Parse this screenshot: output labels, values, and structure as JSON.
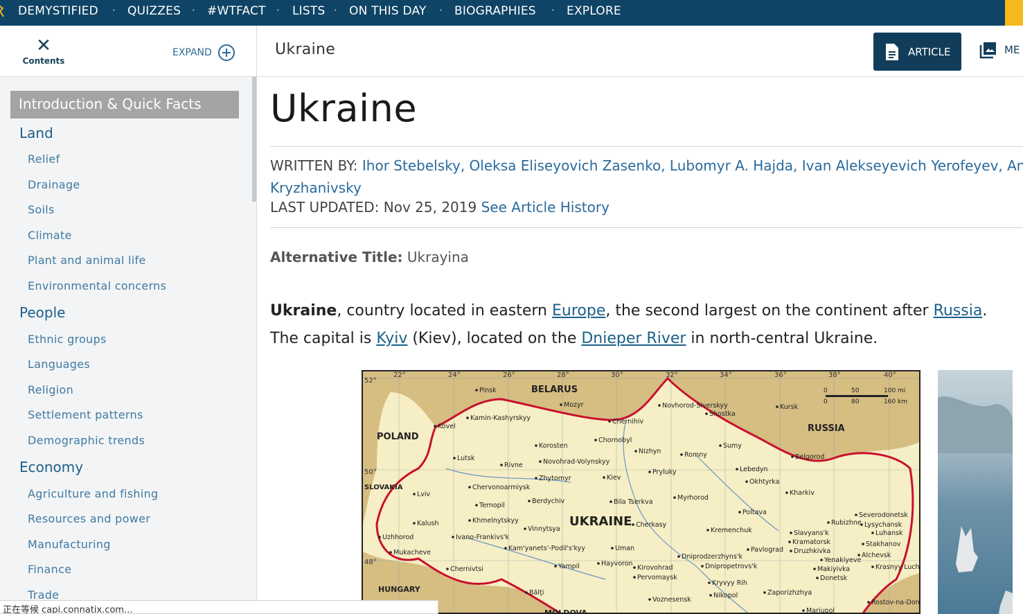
{
  "topnav": {
    "items": [
      "DEMYSTIFIED",
      "QUIZZES",
      "#WTFACT",
      "LISTS",
      "ON THIS DAY",
      "BIOGRAPHIES",
      "EXPLORE"
    ],
    "separator": "·"
  },
  "toc_header": {
    "close_label": "Contents",
    "expand_label": "EXPAND"
  },
  "sidebar": {
    "active": "Introduction & Quick Facts",
    "sections": [
      {
        "label": "Land",
        "items": [
          "Relief",
          "Drainage",
          "Soils",
          "Climate",
          "Plant and animal life",
          "Environmental concerns"
        ]
      },
      {
        "label": "People",
        "items": [
          "Ethnic groups",
          "Languages",
          "Religion",
          "Settlement patterns",
          "Demographic trends"
        ]
      },
      {
        "label": "Economy",
        "items": [
          "Agriculture and fishing",
          "Resources and power",
          "Manufacturing",
          "Finance",
          "Trade"
        ]
      }
    ]
  },
  "header": {
    "title": "Ukraine",
    "article_label": "ARTICLE",
    "media_label": "ME"
  },
  "article": {
    "title": "Ukraine",
    "written_by_label": "WRITTEN BY:",
    "authors_line1": "Ihor Stebelsky, Oleksa Eliseyovich Zasenko, Lubomyr A. Hajda, Ivan Alekseyevich Yerofeyev, Andr",
    "authors_line2": "Kryzhanivsky",
    "last_updated_label": "LAST UPDATED:",
    "last_updated": "Nov 25, 2019",
    "history_link": "See Article History",
    "alt_title_label": "Alternative Title:",
    "alt_title": "Ukrayina",
    "intro": {
      "bold": "Ukraine",
      "t1": ", country located in eastern ",
      "l1": "Europe",
      "t2": ", the second largest on the continent after ",
      "l2": "Russia",
      "t3": ".",
      "t4": "The capital is ",
      "l3": "Kyiv",
      "t5": " (Kiev), located on the ",
      "l4": "Dnieper River",
      "t6": " in north-central Ukraine."
    }
  },
  "map": {
    "country_labels": [
      "BELARUS",
      "POLAND",
      "RUSSIA",
      "SLOVAKIA",
      "HUNGARY",
      "MOLDOVA",
      "UKRAINE"
    ],
    "cities": [
      "Pinsk",
      "Mozyr",
      "Kovel",
      "Kamin-Kashyrskyy",
      "Chernihiv",
      "Novhorod-Siverskyy",
      "Shostka",
      "Kursk",
      "Korosten",
      "Chornobyl",
      "Nizhyn",
      "Romny",
      "Sumy",
      "Lutsk",
      "Rivne",
      "Novohrad-Volynskyy",
      "Zhytomyr",
      "Kiev",
      "Pryluky",
      "Lebedyn",
      "Okhtyrka",
      "Belgorod",
      "Chervonoarmiysk",
      "Lviv",
      "Ternopil",
      "Berdychiv",
      "Bila Tserkva",
      "Myrhorod",
      "Kharkiv",
      "Poltava",
      "Kalush",
      "Khmelnytskyy",
      "Vinnytsya",
      "Cherkasy",
      "Kremenchuk",
      "Rubizhne",
      "Lysychansk",
      "Severodonetsk",
      "Luhansk",
      "Ivano-Frankivs'k",
      "Uzhhorod",
      "Mukacheve",
      "Kam'yanets'-Podil's'kyy",
      "Uman",
      "Dniprodzerzhyns'k",
      "Dnipropetrovs'k",
      "Pavlograd",
      "Slavyans'k",
      "Kramatorsk",
      "Druzhkivka",
      "Stakhanov",
      "Alchevsk",
      "Krasnyy Luch",
      "Yenakiyeve",
      "Makiyivka",
      "Donetsk",
      "Chernivtsi",
      "Yampil",
      "Hayvoron",
      "Kirovohrad",
      "Pervomaysk",
      "Kryvyy Rih",
      "Nikopol",
      "Zaporizhzhya",
      "Bălţi",
      "Voznesensk",
      "Rostov-na-Donu",
      "Mariupol"
    ],
    "scale": [
      "0",
      "50",
      "100 mi",
      "0",
      "80",
      "160 km"
    ],
    "lon_ticks": [
      "22°",
      "24°",
      "26°",
      "28°",
      "30°",
      "32°",
      "34°",
      "36°",
      "38°",
      "40°"
    ],
    "lat_ticks": [
      "52°",
      "50°",
      "48°"
    ]
  },
  "statusbar": {
    "text": "正在等候 capi.connatix.com..."
  },
  "colors": {
    "nav_bg": "#0f4466",
    "accent_gold": "#f6b81c",
    "link": "#1b5f8a",
    "map_land": "#f6eec4",
    "map_outside": "#d6bd82",
    "border_red": "#c8102e"
  }
}
